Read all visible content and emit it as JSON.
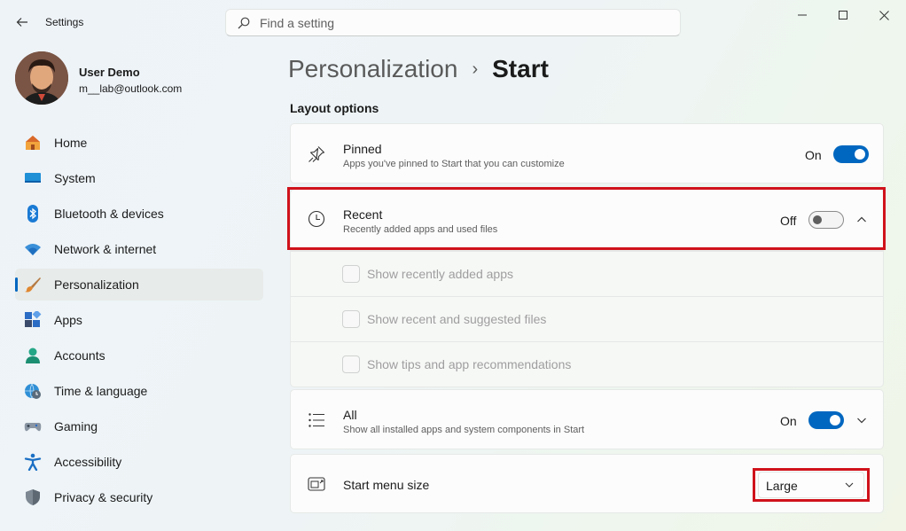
{
  "titlebar": {
    "app_title": "Settings",
    "search_placeholder": "Find a setting"
  },
  "profile": {
    "name": "User Demo",
    "email": "m__lab@outlook.com"
  },
  "sidebar": {
    "items": [
      {
        "label": "Home",
        "icon": "home-icon"
      },
      {
        "label": "System",
        "icon": "system-icon"
      },
      {
        "label": "Bluetooth & devices",
        "icon": "bluetooth-icon"
      },
      {
        "label": "Network & internet",
        "icon": "network-icon"
      },
      {
        "label": "Personalization",
        "icon": "brush-icon",
        "active": true
      },
      {
        "label": "Apps",
        "icon": "apps-icon"
      },
      {
        "label": "Accounts",
        "icon": "accounts-icon"
      },
      {
        "label": "Time & language",
        "icon": "globe-clock-icon"
      },
      {
        "label": "Gaming",
        "icon": "gamepad-icon"
      },
      {
        "label": "Accessibility",
        "icon": "accessibility-icon"
      },
      {
        "label": "Privacy & security",
        "icon": "shield-icon"
      }
    ]
  },
  "main": {
    "breadcrumb_parent": "Personalization",
    "breadcrumb_separator": "›",
    "breadcrumb_current": "Start",
    "section_title": "Layout options",
    "pinned": {
      "title": "Pinned",
      "desc": "Apps you've pinned to Start that you can customize",
      "toggle_label": "On",
      "toggle_state": true
    },
    "recent": {
      "title": "Recent",
      "desc": "Recently added apps and used files",
      "toggle_label": "Off",
      "toggle_state": false,
      "expanded": true,
      "options": [
        "Show recently added apps",
        "Show recent and suggested files",
        "Show tips and app recommendations"
      ]
    },
    "all": {
      "title": "All",
      "desc": "Show all installed apps and system components in Start",
      "toggle_label": "On",
      "toggle_state": true
    },
    "menu_size": {
      "title": "Start menu size",
      "value": "Large"
    }
  },
  "colors": {
    "accent": "#0067c0",
    "highlight": "#d0121b"
  }
}
